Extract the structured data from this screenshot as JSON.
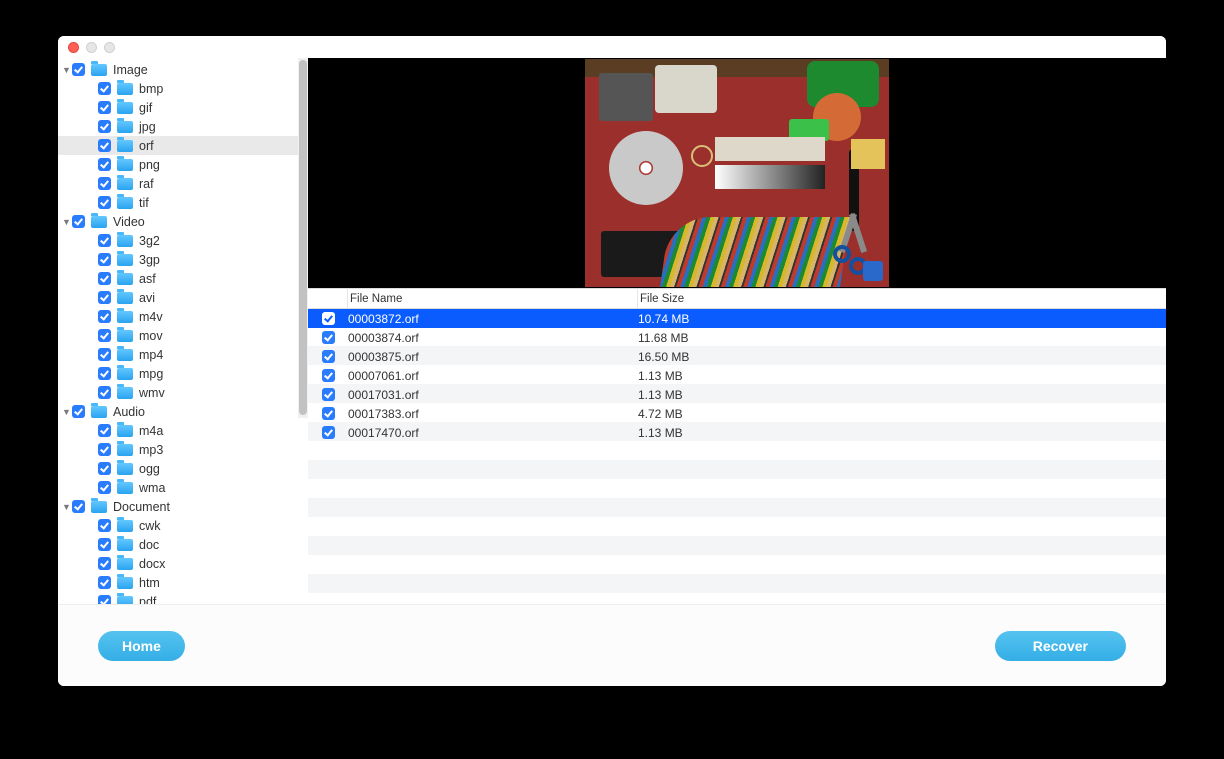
{
  "footer": {
    "home_label": "Home",
    "recover_label": "Recover"
  },
  "table": {
    "headers": {
      "name": "File Name",
      "size": "File Size"
    },
    "rows": [
      {
        "name": "00003872.orf",
        "size": "10.74 MB",
        "selected": true
      },
      {
        "name": "00003874.orf",
        "size": "11.68 MB",
        "selected": false
      },
      {
        "name": "00003875.orf",
        "size": "16.50 MB",
        "selected": false
      },
      {
        "name": "00007061.orf",
        "size": "1.13 MB",
        "selected": false
      },
      {
        "name": "00017031.orf",
        "size": "1.13 MB",
        "selected": false
      },
      {
        "name": "00017383.orf",
        "size": "4.72 MB",
        "selected": false
      },
      {
        "name": "00017470.orf",
        "size": "1.13 MB",
        "selected": false
      }
    ]
  },
  "tree": [
    {
      "label": "Image",
      "level": 0,
      "expanded": true,
      "selected": false
    },
    {
      "label": "bmp",
      "level": 1,
      "selected": false
    },
    {
      "label": "gif",
      "level": 1,
      "selected": false
    },
    {
      "label": "jpg",
      "level": 1,
      "selected": false
    },
    {
      "label": "orf",
      "level": 1,
      "selected": true
    },
    {
      "label": "png",
      "level": 1,
      "selected": false
    },
    {
      "label": "raf",
      "level": 1,
      "selected": false
    },
    {
      "label": "tif",
      "level": 1,
      "selected": false
    },
    {
      "label": "Video",
      "level": 0,
      "expanded": true,
      "selected": false
    },
    {
      "label": "3g2",
      "level": 1,
      "selected": false
    },
    {
      "label": "3gp",
      "level": 1,
      "selected": false
    },
    {
      "label": "asf",
      "level": 1,
      "selected": false
    },
    {
      "label": "avi",
      "level": 1,
      "selected": false
    },
    {
      "label": "m4v",
      "level": 1,
      "selected": false
    },
    {
      "label": "mov",
      "level": 1,
      "selected": false
    },
    {
      "label": "mp4",
      "level": 1,
      "selected": false
    },
    {
      "label": "mpg",
      "level": 1,
      "selected": false
    },
    {
      "label": "wmv",
      "level": 1,
      "selected": false
    },
    {
      "label": "Audio",
      "level": 0,
      "expanded": true,
      "selected": false
    },
    {
      "label": "m4a",
      "level": 1,
      "selected": false
    },
    {
      "label": "mp3",
      "level": 1,
      "selected": false
    },
    {
      "label": "ogg",
      "level": 1,
      "selected": false
    },
    {
      "label": "wma",
      "level": 1,
      "selected": false
    },
    {
      "label": "Document",
      "level": 0,
      "expanded": true,
      "selected": false
    },
    {
      "label": "cwk",
      "level": 1,
      "selected": false
    },
    {
      "label": "doc",
      "level": 1,
      "selected": false
    },
    {
      "label": "docx",
      "level": 1,
      "selected": false
    },
    {
      "label": "htm",
      "level": 1,
      "selected": false
    },
    {
      "label": "pdf",
      "level": 1,
      "selected": false
    }
  ]
}
